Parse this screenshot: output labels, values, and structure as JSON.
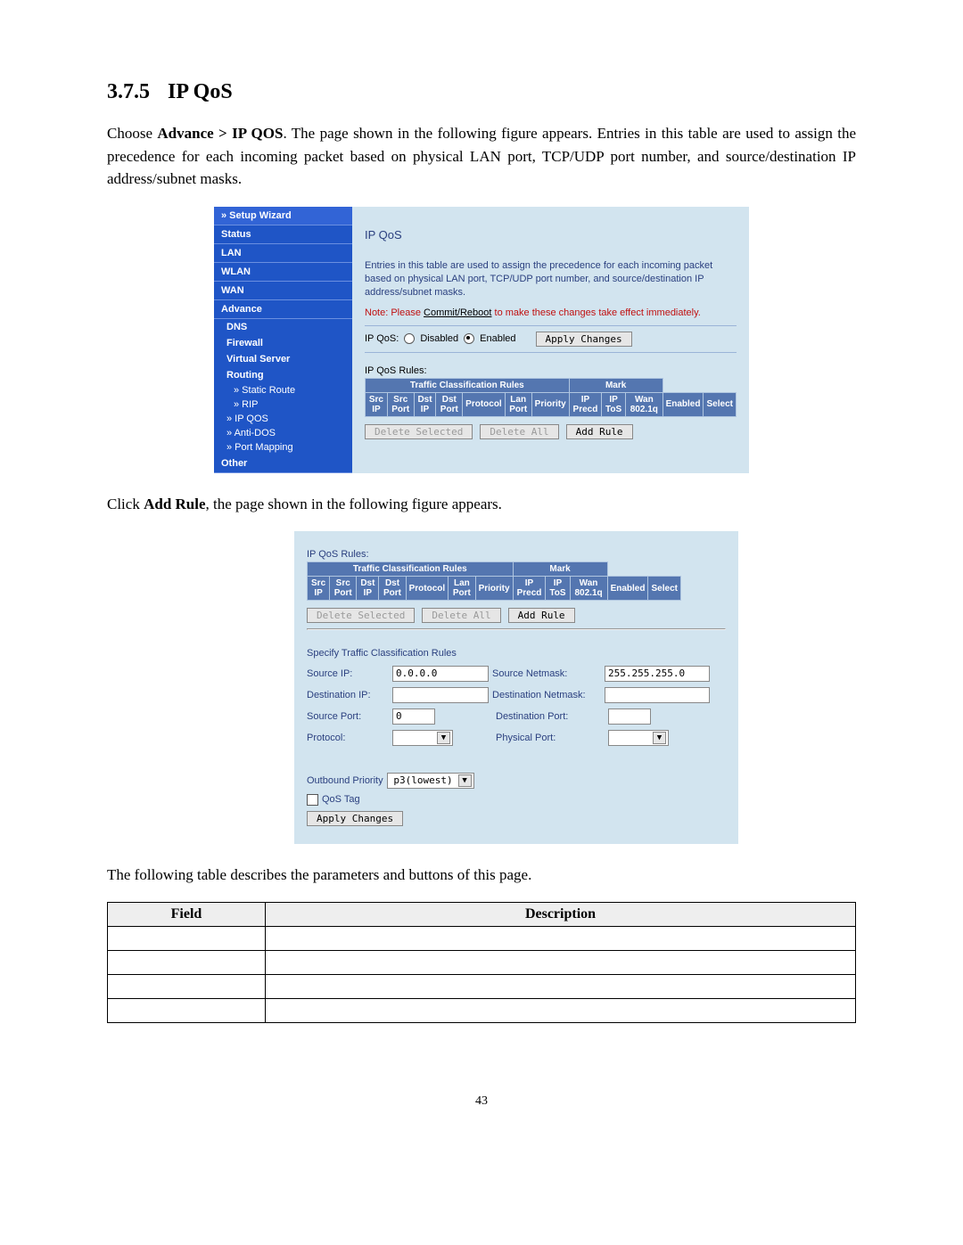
{
  "section": {
    "number": "3.7.5",
    "title": "IP QoS"
  },
  "para1_pre": "Choose ",
  "para1_bold": "Advance > IP QOS",
  "para1_post": ". The page shown in the following figure appears. Entries in this table are used to assign the precedence for each incoming packet based on physical LAN port, TCP/UDP port number, and source/destination IP address/subnet masks.",
  "nav": {
    "setup_wizard": "» Setup Wizard",
    "status": "Status",
    "lan": "LAN",
    "wlan": "WLAN",
    "wan": "WAN",
    "advance": "Advance",
    "dns": "DNS",
    "firewall": "Firewall",
    "virtual_server": "Virtual Server",
    "routing": "Routing",
    "static_route": "» Static Route",
    "rip": "» RIP",
    "ip_qos": "» IP QOS",
    "anti_dos": "» Anti-DOS",
    "port_mapping": "» Port Mapping",
    "other": "Other"
  },
  "panel": {
    "title": "IP QoS",
    "desc": "Entries in this table are used to assign the precedence for each incoming packet based on physical LAN port, TCP/UDP port number, and source/destination IP address/subnet masks.",
    "note_pre": "Note: Please ",
    "note_link": "Commit/Reboot",
    "note_post": " to make these changes take effect immediately.",
    "qos_label": "IP QoS:",
    "disabled": "Disabled",
    "enabled": "Enabled",
    "apply": "Apply Changes",
    "rules_label": "IP QoS Rules:",
    "grp1": "Traffic Classification Rules",
    "grp2": "Mark",
    "cols": {
      "src_ip": "Src IP",
      "src_port": "Src Port",
      "dst_ip": "Dst IP",
      "dst_port": "Dst Port",
      "protocol": "Protocol",
      "lan_port": "Lan Port",
      "priority": "Priority",
      "ip_precd": "IP Precd",
      "ip_tos": "IP ToS",
      "wan_8021q": "Wan 802.1q",
      "enabled": "Enabled",
      "select": "Select"
    },
    "btn_delete_selected": "Delete Selected",
    "btn_delete_all": "Delete All",
    "btn_add_rule": "Add Rule"
  },
  "para2_pre": "Click ",
  "para2_bold": "Add Rule",
  "para2_post": ", the page shown in the following figure appears.",
  "form": {
    "spec_title": "Specify Traffic Classification Rules",
    "source_ip": "Source IP:",
    "source_ip_val": "0.0.0.0",
    "source_netmask": "Source Netmask:",
    "source_netmask_val": "255.255.255.0",
    "dest_ip": "Destination IP:",
    "dest_netmask": "Destination Netmask:",
    "source_port": "Source Port:",
    "source_port_val": "0",
    "dest_port": "Destination Port:",
    "protocol": "Protocol:",
    "physical_port": "Physical Port:",
    "outbound_priority": "Outbound Priority",
    "outbound_priority_val": "p3(lowest)",
    "qos_tag": "QoS Tag",
    "apply": "Apply Changes"
  },
  "para3": "The following table describes the parameters and buttons of this page.",
  "table": {
    "h_field": "Field",
    "h_desc": "Description"
  },
  "page_number": "43"
}
